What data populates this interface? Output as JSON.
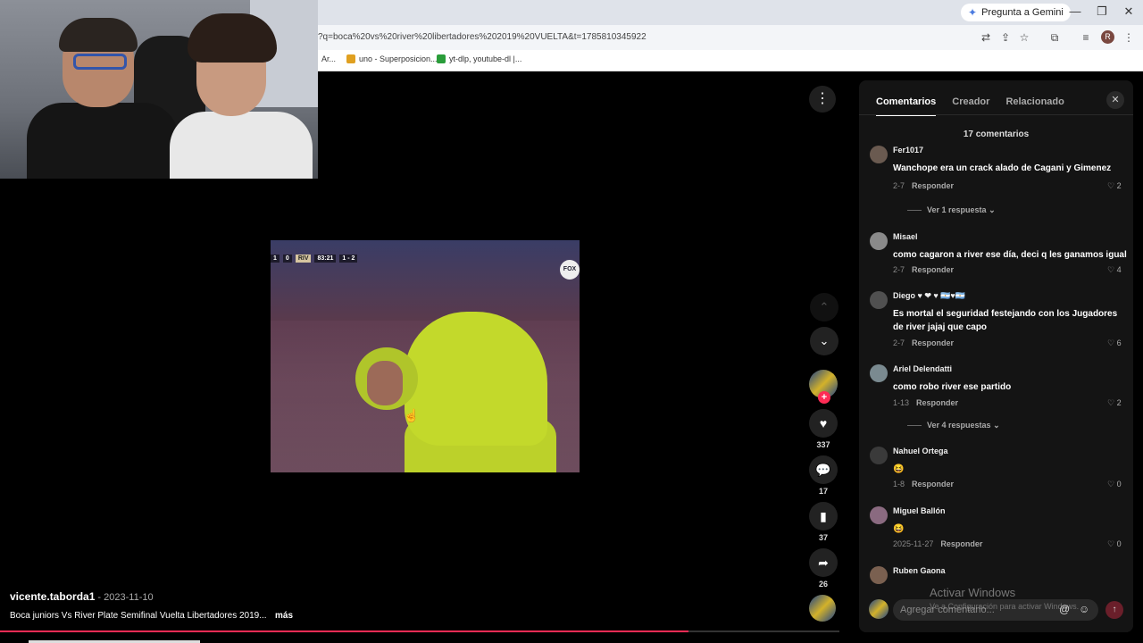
{
  "browser": {
    "gemini_label": "Pregunta a Gemini",
    "url": "?q=boca%20vs%20river%20libertadores%202019%20VUELTA&t=1785810345922",
    "profile_initial": "R",
    "bookmarks": [
      {
        "label": "Ar...",
        "color": "#888888"
      },
      {
        "label": "uno - Superposicion...",
        "color": "#e0a020"
      },
      {
        "label": "yt-dlp, youtube-dl |...",
        "color": "#2a9d3a"
      }
    ]
  },
  "video": {
    "score_home": "1",
    "score_away": "0",
    "team": "RIV",
    "clock": "83:21",
    "agg": "1 - 2",
    "broadcaster": "FOX",
    "progress_fraction": 0.82
  },
  "actions": {
    "likes": "337",
    "comments": "17",
    "saves": "37",
    "shares": "26"
  },
  "post": {
    "author": "vicente.taborda1",
    "date": " - 2023-11-10",
    "caption": "Boca juniors Vs River Plate Semifinal Vuelta Libertadores 2019...",
    "more": "más"
  },
  "panel": {
    "tabs": [
      "Comentarios",
      "Creador",
      "Relacionado"
    ],
    "count_label": "17 comentarios",
    "comments": [
      {
        "user": "Fer1017",
        "text": "Wanchope era un crack alado de Cagani y Gimenez",
        "date": "2-7",
        "reply": "Responder",
        "likes": "2",
        "view_replies": "Ver 1 respuesta"
      },
      {
        "user": "Misael",
        "text": "como cagaron a river ese día, deci q les ganamos igual",
        "date": "2-7",
        "reply": "Responder",
        "likes": "4",
        "view_replies": ""
      },
      {
        "user": "Diego ♥ ❤ ♥ 🇦🇷♥🇦🇷",
        "text": "Es mortal el seguridad festejando con los Jugadores de river jajaj que capo",
        "date": "2-7",
        "reply": "Responder",
        "likes": "6",
        "view_replies": ""
      },
      {
        "user": "Ariel Delendatti",
        "text": "como robo river ese partido",
        "date": "1-13",
        "reply": "Responder",
        "likes": "2",
        "view_replies": "Ver 4 respuestas"
      },
      {
        "user": "Nahuel Ortega",
        "text": "😆",
        "date": "1-8",
        "reply": "Responder",
        "likes": "0",
        "view_replies": ""
      },
      {
        "user": "Miguel Ballón",
        "text": "😆",
        "date": "2025-11-27",
        "reply": "Responder",
        "likes": "0",
        "view_replies": ""
      },
      {
        "user": "Ruben Gaona",
        "text": "",
        "date": "",
        "reply": "",
        "likes": "",
        "view_replies": ""
      }
    ],
    "input_placeholder": "Agregar comentario..."
  },
  "watermark": {
    "title": "Activar Windows",
    "subtitle": "Ve a Configuración para activar Windows."
  }
}
